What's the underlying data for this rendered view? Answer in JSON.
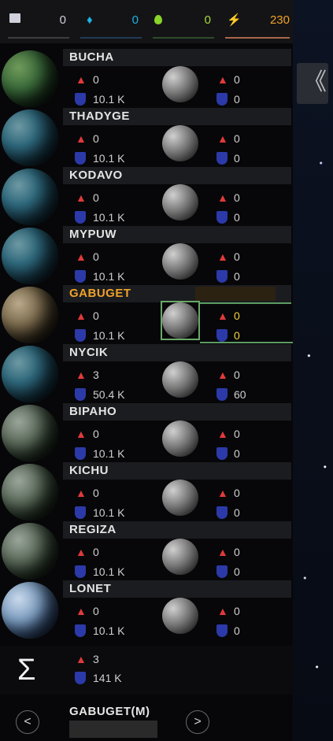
{
  "resources": [
    {
      "value": "0",
      "icon": "book-icon",
      "color": "#cfd2dc"
    },
    {
      "value": "0",
      "icon": "crystal-icon",
      "color": "#1fb2e6"
    },
    {
      "value": "0",
      "icon": "drop-icon",
      "color": "#89d32a"
    },
    {
      "value": "230",
      "icon": "lightning-icon",
      "color": "#f08a2a"
    }
  ],
  "resource_bar_colors": [
    "#3c3c40",
    "#223a55",
    "#2e4a2a",
    "#a8674a"
  ],
  "resource_value_colors": [
    "#cfd2dc",
    "#1fb2e6",
    "#a6d836",
    "#f0a22a"
  ],
  "collapse_label": "《",
  "planets": [
    {
      "name": "BUCHA",
      "fleet": "0",
      "defense": "10.1 K",
      "moon_fleet": "0",
      "moon_defense": "0",
      "texture": "green"
    },
    {
      "name": "THADYGE",
      "fleet": "0",
      "defense": "10.1 K",
      "moon_fleet": "0",
      "moon_defense": "0",
      "texture": "ocean"
    },
    {
      "name": "KODAVO",
      "fleet": "0",
      "defense": "10.1 K",
      "moon_fleet": "0",
      "moon_defense": "0",
      "texture": "ocean"
    },
    {
      "name": "MYPUW",
      "fleet": "0",
      "defense": "10.1 K",
      "moon_fleet": "0",
      "moon_defense": "0",
      "texture": "ocean"
    },
    {
      "name": "GABUGET",
      "fleet": "0",
      "defense": "10.1 K",
      "moon_fleet": "0",
      "moon_defense": "0",
      "texture": "desert",
      "active": true
    },
    {
      "name": "NYCIK",
      "fleet": "3",
      "defense": "50.4 K",
      "moon_fleet": "0",
      "moon_defense": "60",
      "texture": "ocean"
    },
    {
      "name": "BIPAHO",
      "fleet": "0",
      "defense": "10.1 K",
      "moon_fleet": "0",
      "moon_defense": "0",
      "texture": "forest"
    },
    {
      "name": "KICHU",
      "fleet": "0",
      "defense": "10.1 K",
      "moon_fleet": "0",
      "moon_defense": "0",
      "texture": "forest"
    },
    {
      "name": "REGIZA",
      "fleet": "0",
      "defense": "10.1 K",
      "moon_fleet": "0",
      "moon_defense": "0",
      "texture": "forest"
    },
    {
      "name": "LONET",
      "fleet": "0",
      "defense": "10.1 K",
      "moon_fleet": "0",
      "moon_defense": "0",
      "texture": "ice"
    }
  ],
  "summary": {
    "symbol": "Σ",
    "fleet": "3",
    "defense": "141 K"
  },
  "footer": {
    "prev": "<",
    "next": ">",
    "current_planet": "GABUGET(M)"
  }
}
